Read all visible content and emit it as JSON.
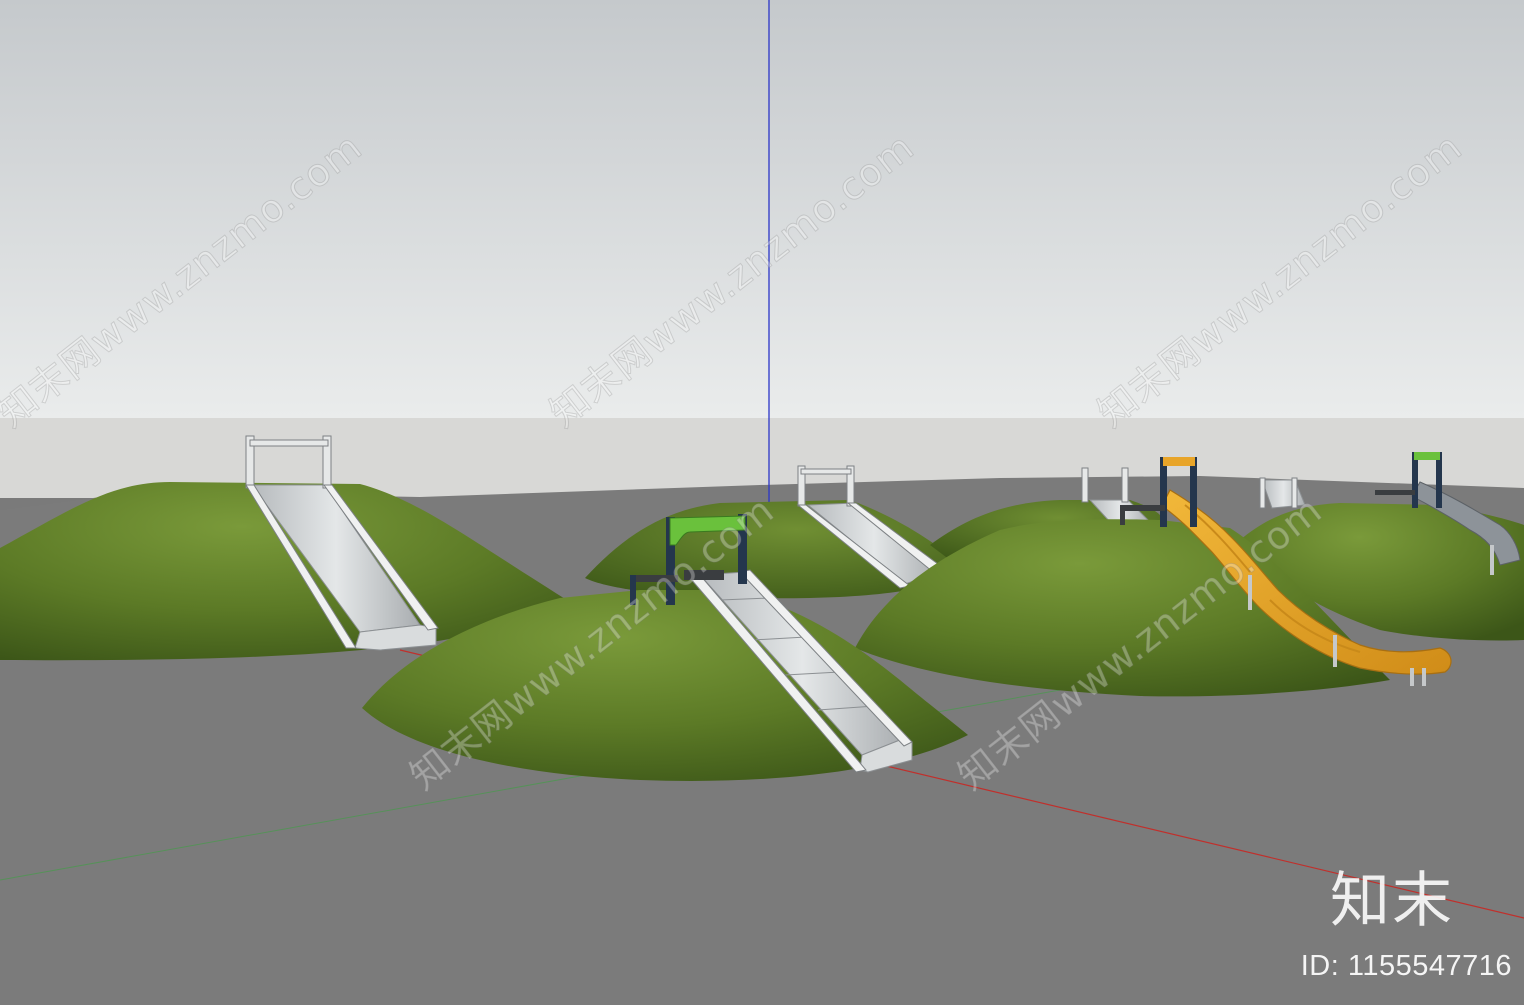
{
  "watermark": {
    "text": "知末网www.znzmo.com"
  },
  "brand": {
    "logo_text": "知末",
    "id_text": "ID: 1155547716"
  },
  "colors": {
    "sky_top": "#c6cacd",
    "sky_bottom": "#e9ebeb",
    "horizon_band": "#d9d9d7",
    "ground": "#7b7b7b",
    "grass_light": "#6e8d34",
    "grass_dark": "#3a5216",
    "slide_steel": "#cfd3d4",
    "slide_yellow": "#e8a52a",
    "frame_green": "#6ac13c",
    "frame_navy": "#24364d",
    "axis_red": "#c0302c",
    "axis_green": "#3fa043",
    "axis_blue": "#2b35c8"
  }
}
